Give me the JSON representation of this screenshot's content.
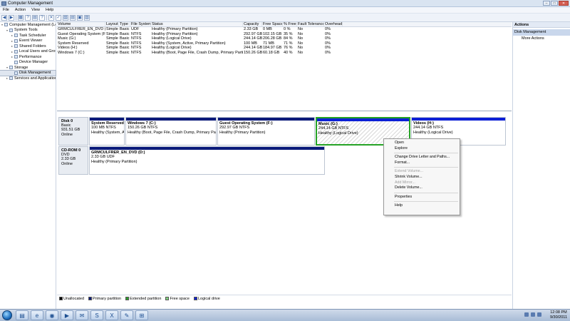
{
  "window": {
    "title": "Computer Management",
    "controls": [
      "–",
      "□",
      "✕"
    ]
  },
  "menu": [
    "File",
    "Action",
    "View",
    "Help"
  ],
  "toolbar": [
    "◀",
    "▶",
    "▦",
    "?",
    "▤",
    "?",
    "✕",
    "✓",
    "▧",
    "▤",
    "▣",
    "▨"
  ],
  "tree": [
    {
      "label": "Computer Management (Local)",
      "level": 0,
      "arrow": "▾"
    },
    {
      "label": "System Tools",
      "level": 1,
      "arrow": "▾"
    },
    {
      "label": "Task Scheduler",
      "level": 2,
      "arrow": "▸"
    },
    {
      "label": "Event Viewer",
      "level": 2,
      "arrow": "▸"
    },
    {
      "label": "Shared Folders",
      "level": 2,
      "arrow": "▸"
    },
    {
      "label": "Local Users and Groups",
      "level": 2,
      "arrow": "▸"
    },
    {
      "label": "Performance",
      "level": 2,
      "arrow": "▸"
    },
    {
      "label": "Device Manager",
      "level": 2,
      "arrow": ""
    },
    {
      "label": "Storage",
      "level": 1,
      "arrow": "▾"
    },
    {
      "label": "Disk Management",
      "level": 2,
      "arrow": "",
      "selected": true
    },
    {
      "label": "Services and Applications",
      "level": 1,
      "arrow": "▸"
    }
  ],
  "volumes": {
    "headers": [
      "Volume",
      "Layout",
      "Type",
      "File System",
      "Status",
      "Capacity",
      "Free Space",
      "% Free",
      "Fault Tolerance",
      "Overhead"
    ],
    "rows": [
      [
        "GRMCULFRER_EN_DVD (D:)",
        "Simple",
        "Basic",
        "UDF",
        "Healthy (Primary Partition)",
        "2.33 GB",
        "0 MB",
        "0 %",
        "No",
        "0%"
      ],
      [
        "Guest Operating System (F:)",
        "Simple",
        "Basic",
        "NTFS",
        "Healthy (Primary Partition)",
        "292.97 GB",
        "102.15 GB",
        "35 %",
        "No",
        "0%"
      ],
      [
        "Music (G:)",
        "Simple",
        "Basic",
        "NTFS",
        "Healthy (Logical Drive)",
        "244.14 GB",
        "206.28 GB",
        "84 %",
        "No",
        "0%"
      ],
      [
        "System Reserved",
        "Simple",
        "Basic",
        "NTFS",
        "Healthy (System, Active, Primary Partition)",
        "100 MB",
        "71 MB",
        "71 %",
        "No",
        "0%"
      ],
      [
        "Videos (H:)",
        "Simple",
        "Basic",
        "NTFS",
        "Healthy (Logical Drive)",
        "244.14 GB",
        "184.97 GB",
        "76 %",
        "No",
        "0%"
      ],
      [
        "Windows 7 (C:)",
        "Simple",
        "Basic",
        "NTFS",
        "Healthy (Boot, Page File, Crash Dump, Primary Partition)",
        "150.26 GB",
        "60.18 GB",
        "40 %",
        "No",
        "0%"
      ]
    ]
  },
  "disks": [
    {
      "name": "Disk 0",
      "type": "Basic",
      "size": "931.51 GB",
      "state": "Online",
      "partitions": [
        {
          "name": "System Reserved",
          "size": "100 MB NTFS",
          "status": "Healthy (System, Ac",
          "kind": "primary"
        },
        {
          "name": "Windows 7 (C:)",
          "size": "150.26 GB NTFS",
          "status": "Healthy (Boot, Page File, Crash Dump, Primary Partition)",
          "kind": "primary"
        },
        {
          "name": "Guest Operating System (F:)",
          "size": "292.97 GB NTFS",
          "status": "Healthy (Primary Partition)",
          "kind": "primary"
        },
        {
          "name": "Music (G:)",
          "size": "244.14 GB NTFS",
          "status": "Healthy (Logical Drive)",
          "kind": "logical",
          "selected": true
        },
        {
          "name": "Videos (H:)",
          "size": "244.14 GB NTFS",
          "status": "Healthy (Logical Drive)",
          "kind": "logical"
        }
      ]
    },
    {
      "name": "CD-ROM 0",
      "type": "DVD",
      "size": "2.33 GB",
      "state": "Online",
      "partitions": [
        {
          "name": "GRMCULFRER_EN_DVD (D:)",
          "size": "2.33 GB UDF",
          "status": "Healthy (Primary Partition)",
          "kind": "primary"
        }
      ]
    }
  ],
  "legend": [
    {
      "label": "Unallocated",
      "color": "#000000"
    },
    {
      "label": "Primary partition",
      "color": "#0a1a7a"
    },
    {
      "label": "Extended partition",
      "color": "#2c9f2c"
    },
    {
      "label": "Free space",
      "color": "#7fd07f"
    },
    {
      "label": "Logical drive",
      "color": "#0b1fd6"
    }
  ],
  "actions": {
    "header": "Actions",
    "section": "Disk Management",
    "more": "More Actions"
  },
  "context_menu": [
    {
      "label": "Open",
      "enabled": true
    },
    {
      "label": "Explore",
      "enabled": true
    },
    {
      "sep": true
    },
    {
      "label": "Change Drive Letter and Paths...",
      "enabled": true
    },
    {
      "label": "Format...",
      "enabled": true
    },
    {
      "sep": true
    },
    {
      "label": "Extend Volume...",
      "enabled": false
    },
    {
      "label": "Shrink Volume...",
      "enabled": true
    },
    {
      "label": "Add Mirror...",
      "enabled": false
    },
    {
      "label": "Delete Volume...",
      "enabled": true
    },
    {
      "sep": true
    },
    {
      "label": "Properties",
      "enabled": true
    },
    {
      "sep": true
    },
    {
      "label": "Help",
      "enabled": true
    }
  ],
  "taskbar": {
    "apps": [
      "folder-icon",
      "ie-icon",
      "firefox-icon",
      "media-icon",
      "chat-icon",
      "skype-icon",
      "excel-icon",
      "paint-icon",
      "network-icon"
    ],
    "time": "12:08 PM",
    "date": "9/30/2011"
  }
}
